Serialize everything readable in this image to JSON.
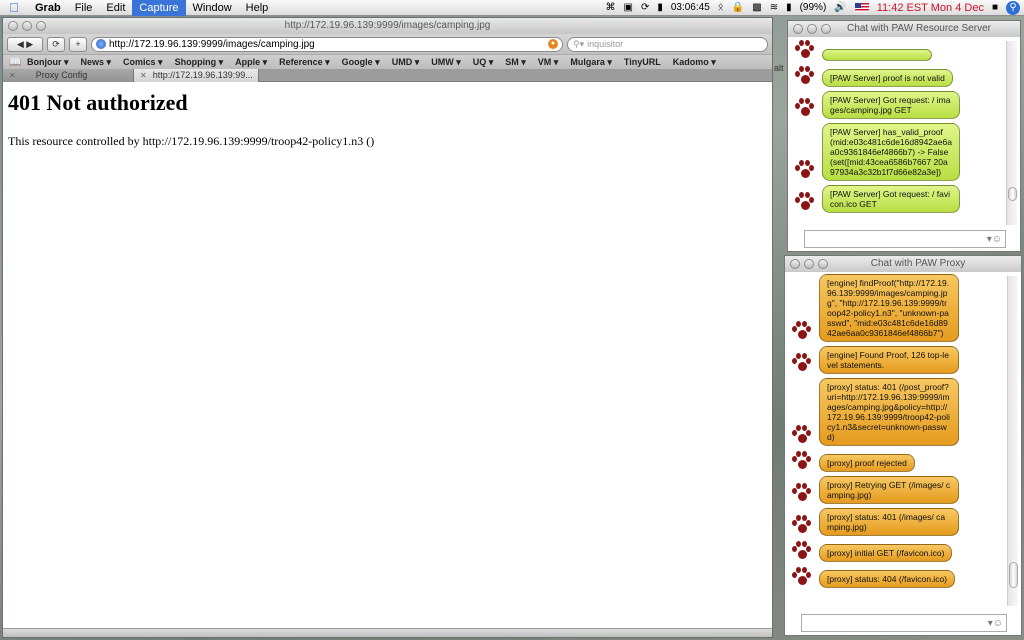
{
  "menubar": {
    "app": "Grab",
    "items": [
      "File",
      "Edit",
      "Capture",
      "Window",
      "Help"
    ],
    "active": "Capture",
    "status_time": "03:06:45",
    "battery": "(99%)",
    "clock": "11:42 EST Mon 4 Dec"
  },
  "browser": {
    "title": "http://172.19.96.139:9999/images/camping.jpg",
    "url": "http://172.19.96.139:9999/images/camping.jpg",
    "search_placeholder": "inquisitor",
    "bookmarks": [
      "Bonjour ▾",
      "News ▾",
      "Comics ▾",
      "Shopping ▾",
      "Apple ▾",
      "Reference ▾",
      "Google ▾",
      "UMD ▾",
      "UMW ▾",
      "UQ ▾",
      "SM ▾",
      "VM ▾",
      "Mulgara ▾",
      "TinyURL",
      "Kadomo ▾"
    ],
    "tabs": [
      {
        "label": "Proxy Config"
      },
      {
        "label": "http://172.19.96.139:99..."
      }
    ],
    "heading": "401 Not authorized",
    "body_text": "This resource controlled by http://172.19.96.139:9999/troop42-policy1.n3 ()"
  },
  "edge_label": "alt",
  "chat_server": {
    "title": "Chat with PAW Resource Server",
    "messages": [
      {
        "text": "",
        "color": "green"
      },
      {
        "text": "[PAW Server] proof is not valid",
        "color": "green"
      },
      {
        "text": "[PAW Server] Got request: / images/camping.jpg GET",
        "color": "green"
      },
      {
        "text": "[PAW Server] has_valid_proof (mid:e03c481c6de16d8942ae6aa0c9361846ef4866b7) -> False (set([mid:43cea6586b7667 20a97934a3c32b1f7d66e82a3e])",
        "color": "green"
      },
      {
        "text": "[PAW Server] Got request: / favicon.ico GET",
        "color": "green"
      }
    ]
  },
  "chat_proxy": {
    "title": "Chat with PAW Proxy",
    "messages": [
      {
        "text": "[engine] findProof(\"http://172.19.96.139:9999/images/camping.jpg\", \"http://172.19.96.139:9999/troop42-policy1.n3\", \"unknown-passwd\", \"mid:e03c481c6de16d8942ae6aa0c9361846ef4866b7\")",
        "color": "orange"
      },
      {
        "text": "[engine] Found Proof, 126 top-level statements.",
        "color": "orange"
      },
      {
        "text": "[proxy] status: 401 (/post_proof?uri=http://172.19.96.139:9999/images/camping.jpg&policy=http://172.19.96.139:9999/troop42-policy1.n3&secret=unknown-passwd)",
        "color": "orange"
      },
      {
        "text": "[proxy] proof rejected",
        "color": "orange"
      },
      {
        "text": "[proxy] Retrying GET (/images/ camping.jpg)",
        "color": "orange"
      },
      {
        "text": "[proxy] status: 401 (/images/ camping.jpg)",
        "color": "orange"
      },
      {
        "text": "[proxy] initial GET (/favicon.ico)",
        "color": "orange"
      },
      {
        "text": "[proxy] status: 404 (/favicon.ico)",
        "color": "orange"
      }
    ]
  }
}
